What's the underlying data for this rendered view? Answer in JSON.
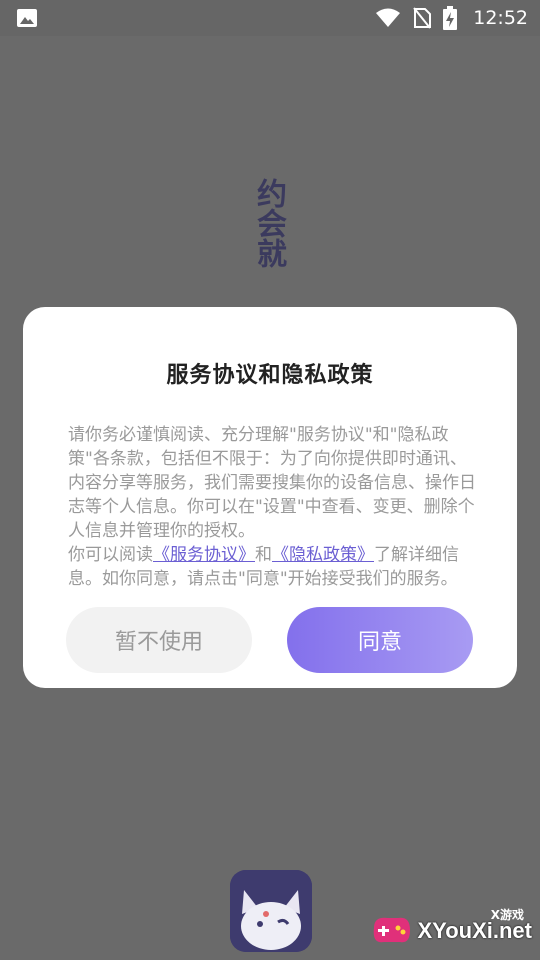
{
  "status_bar": {
    "time": "12:52",
    "icons": [
      "image-icon",
      "wifi-icon",
      "no-sim-icon",
      "battery-charging-icon"
    ]
  },
  "background": {
    "title_vertical": "约会就"
  },
  "dialog": {
    "title": "服务协议和隐私政策",
    "paragraph1": "请你务必谨慎阅读、充分理解\"服务协议\"和\"隐私政策\"各条款，包括但不限于：为了向你提供即时通讯、内容分享等服务，我们需要搜集你的设备信息、操作日志等个人信息。你可以在\"设置\"中查看、变更、删除个人信息并管理你的授权。",
    "paragraph2_prefix": "你可以阅读",
    "service_link": "《服务协议》",
    "paragraph2_and": "和",
    "privacy_link": "《隐私政策》",
    "paragraph2_suffix": "了解详细信息。如你同意，请点击\"同意\"开始接受我们的服务。",
    "decline_button": "暂不使用",
    "agree_button": "同意"
  },
  "watermark": {
    "small_text": "X游戏",
    "main_text": "XYouXi.net"
  }
}
